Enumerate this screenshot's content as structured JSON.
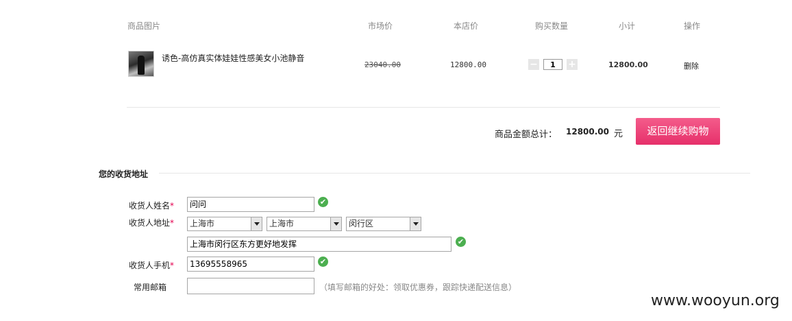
{
  "cart": {
    "headers": [
      "商品图片",
      "市场价",
      "本店价",
      "购买数量",
      "小计",
      "操作"
    ],
    "item": {
      "image_icon": "product-thumbnail",
      "name": "诱色-高仿真实体娃娃性感美女小池静音",
      "market_price": "23040.00",
      "shop_price": "12800.00",
      "quantity": "1",
      "minus": "−",
      "plus": "+",
      "subtotal": "12800.00",
      "delete_label": "删除"
    },
    "total_label": "商品金额总计：",
    "total_value": "12800.00",
    "currency": "元",
    "back_button": "返回继续购物"
  },
  "address": {
    "section_title": "您的收货地址",
    "name_label": "收货人姓名",
    "name_value": "问问",
    "addr_label": "收货人地址",
    "province": "上海市",
    "city": "上海市",
    "district": "闵行区",
    "street_value": "上海市闵行区东方更好地发挥",
    "phone_label": "收货人手机",
    "phone_value": "13695558965",
    "email_label": "常用邮箱",
    "email_value": "",
    "email_hint": "（填写邮箱的好处：领取优惠券，跟踪快递配送信息）",
    "required_mark": "*",
    "check_mark": "✔"
  },
  "watermark": "www.wooyun.org",
  "colors": {
    "accent": "#e6306a",
    "required": "#e4004f",
    "valid": "#4caf50"
  }
}
